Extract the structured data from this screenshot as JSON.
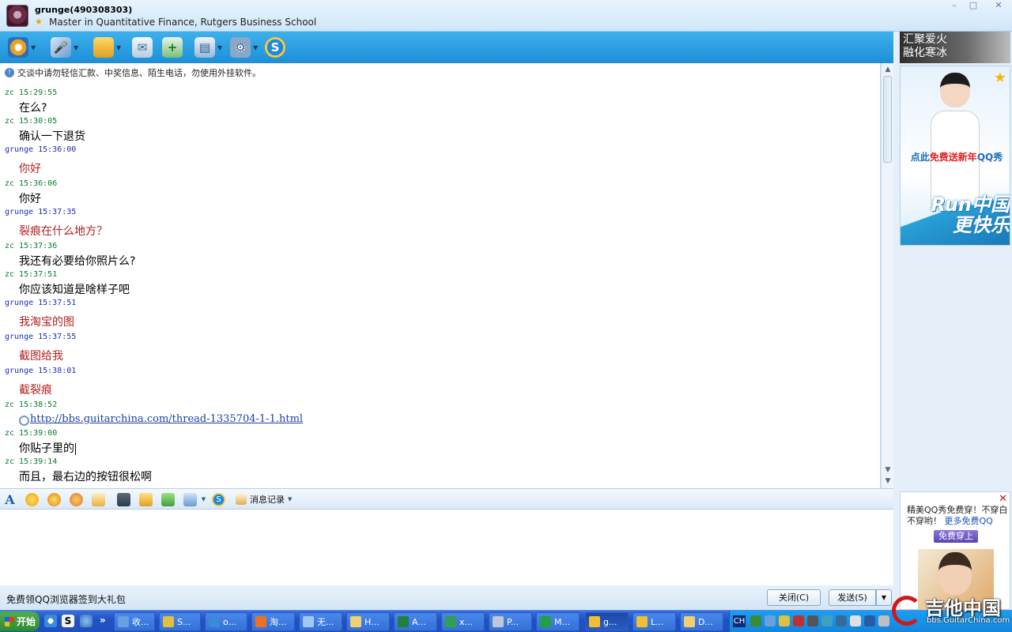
{
  "window": {
    "contact_name": "grunge(490308303)",
    "contact_signature": "Master in Quantitative Finance, Rutgers Business School",
    "minimize": "–",
    "maximize": "□",
    "close": "✕"
  },
  "toolbar": {
    "items": [
      {
        "icon": "video-call-icon",
        "has_dropdown": true
      },
      {
        "icon": "microphone-icon",
        "has_dropdown": true
      },
      {
        "icon": "folder-transfer-icon",
        "has_dropdown": true
      },
      {
        "icon": "mail-icon",
        "has_dropdown": false
      },
      {
        "icon": "add-group-icon",
        "has_dropdown": false
      },
      {
        "icon": "tools-icon",
        "has_dropdown": true
      },
      {
        "icon": "settings-icon",
        "has_dropdown": true
      },
      {
        "icon": "paypal-s-icon",
        "has_dropdown": false
      }
    ]
  },
  "chat": {
    "notice": "交谈中请勿轻信汇款、中奖信息、陌生电话，勿使用外挂软件。",
    "messages": [
      {
        "sender": "zc",
        "time": "15:29:55",
        "text": "在么?"
      },
      {
        "sender": "zc",
        "time": "15:30:05",
        "text": "确认一下退货"
      },
      {
        "sender": "grunge",
        "time": "15:36:00",
        "text": "你好"
      },
      {
        "sender": "zc",
        "time": "15:36:06",
        "text": "你好"
      },
      {
        "sender": "grunge",
        "time": "15:37:35",
        "text": "裂痕在什么地方？"
      },
      {
        "sender": "zc",
        "time": "15:37:36",
        "text": "我还有必要给你照片么?"
      },
      {
        "sender": "zc",
        "time": "15:37:51",
        "text": "你应该知道是啥样子吧"
      },
      {
        "sender": "grunge",
        "time": "15:37:51",
        "text": "我淘宝的图"
      },
      {
        "sender": "grunge",
        "time": "15:37:55",
        "text": "截图给我"
      },
      {
        "sender": "grunge",
        "time": "15:38:01",
        "text": "截裂痕"
      },
      {
        "sender": "zc",
        "time": "15:38:52",
        "link": "http://bbs.guitarchina.com/thread-1335704-1-1.html"
      },
      {
        "sender": "zc",
        "time": "15:39:00",
        "text": "你贴子里的"
      },
      {
        "sender": "zc",
        "time": "15:39:14",
        "text": "而且，最右边的按钮很松啊"
      }
    ]
  },
  "input_toolbar": {
    "icons": [
      "font-icon",
      "emoticon-icon",
      "magic-emoticon-icon",
      "shake-icon",
      "doodle-icon",
      "screenshot-icon",
      "music-icon",
      "gift-icon",
      "image-icon",
      "paypal-icon"
    ],
    "history_label": "消息记录"
  },
  "bottom": {
    "promo": "免费领QQ浏览器签到大礼包",
    "close_label": "关闭(C)",
    "send_label": "发送(S)"
  },
  "side": {
    "banner_line1": "汇聚爱火",
    "banner_line2": "融化寒冰",
    "qqshow_cta_prefix": "点此",
    "qqshow_cta_em": "免费送新年",
    "qqshow_cta_suffix": "QQ秀",
    "run_text": "Run中国 更快乐",
    "ad_text": "精美QQ秀免费穿！不穿白不穿哟！",
    "ad_more": "更多免费QQ",
    "ad_button": "免费穿上"
  },
  "taskbar": {
    "start_label": "开始",
    "tasks": [
      {
        "label": "收...",
        "color": "#6a9fe0"
      },
      {
        "label": "S...",
        "color": "#e0c040"
      },
      {
        "label": "o...",
        "color": "#3a8ad8"
      },
      {
        "label": "淘...",
        "color": "#f07020"
      },
      {
        "label": "无...",
        "color": "#a0c8f0"
      },
      {
        "label": "H...",
        "color": "#f0d070"
      },
      {
        "label": "A...",
        "color": "#208040"
      },
      {
        "label": "x...",
        "color": "#30a050"
      },
      {
        "label": "P...",
        "color": "#c0c8d8"
      },
      {
        "label": "M...",
        "color": "#20a040"
      },
      {
        "label": "g...",
        "color": "#f0c030",
        "active": true
      },
      {
        "label": "L...",
        "color": "#f0c030"
      },
      {
        "label": "D...",
        "color": "#f0d070"
      }
    ],
    "lang": "CH"
  },
  "watermark": {
    "cn": "吉他中国",
    "en": "bbs.GuitarChina.com"
  }
}
